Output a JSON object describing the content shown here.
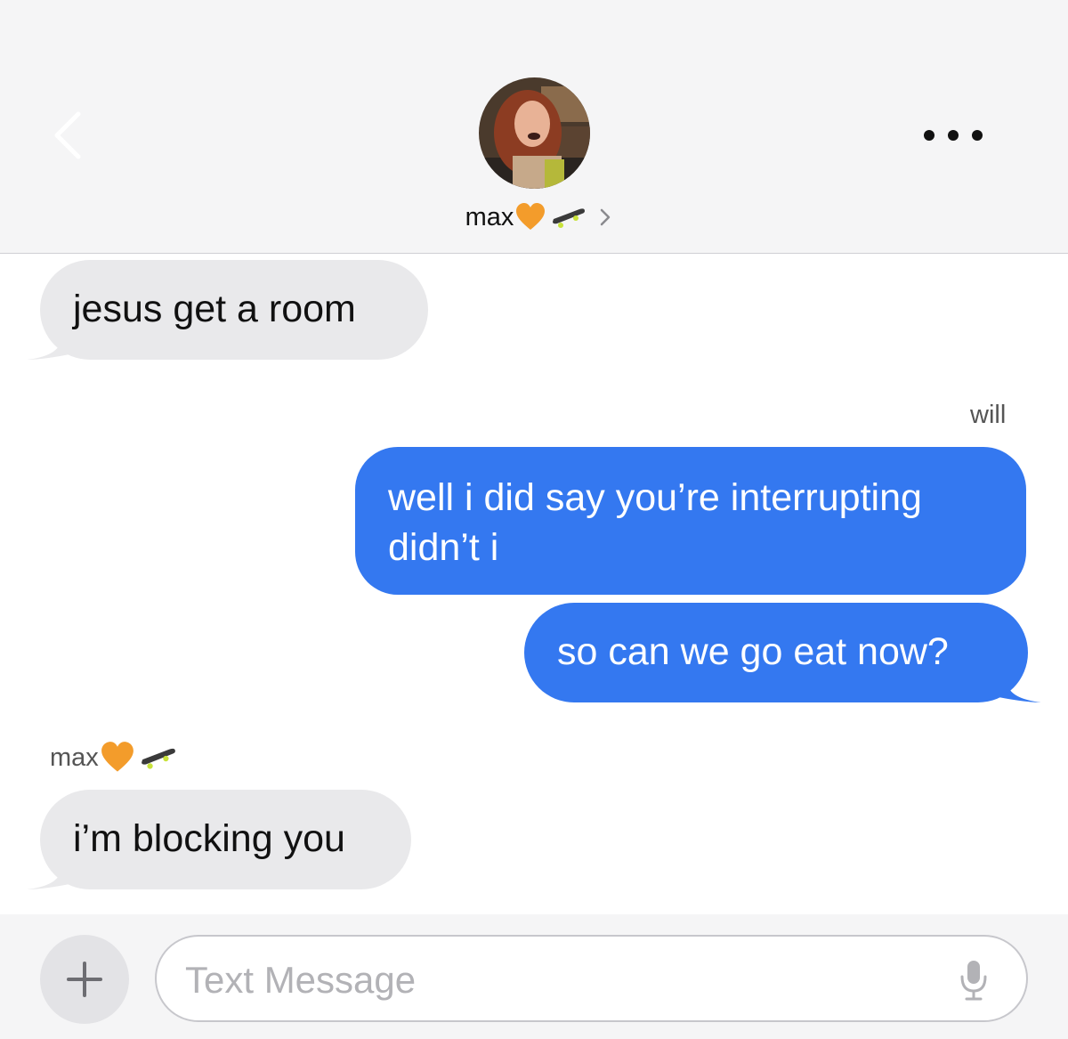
{
  "header": {
    "contact_name": "max",
    "contact_emojis": [
      "orange-heart",
      "skateboard"
    ]
  },
  "messages": [
    {
      "direction": "incoming",
      "sender": "",
      "text": "jesus get a room"
    },
    {
      "direction": "outgoing",
      "sender": "will",
      "text": "well i did say you’re interrupting didn’t i"
    },
    {
      "direction": "outgoing",
      "sender": "",
      "text": "so can we go eat now?"
    },
    {
      "direction": "incoming",
      "sender": "max",
      "text": "i’m blocking you"
    }
  ],
  "input": {
    "placeholder": "Text Message",
    "value": ""
  },
  "colors": {
    "outgoing_bubble": "#3478f0",
    "incoming_bubble": "#e9e9eb",
    "header_bg": "#f5f5f6",
    "heart": "#f39c2b"
  },
  "icons": [
    "back-chevron-icon",
    "more-icon",
    "chevron-right-icon",
    "plus-icon",
    "microphone-icon"
  ]
}
